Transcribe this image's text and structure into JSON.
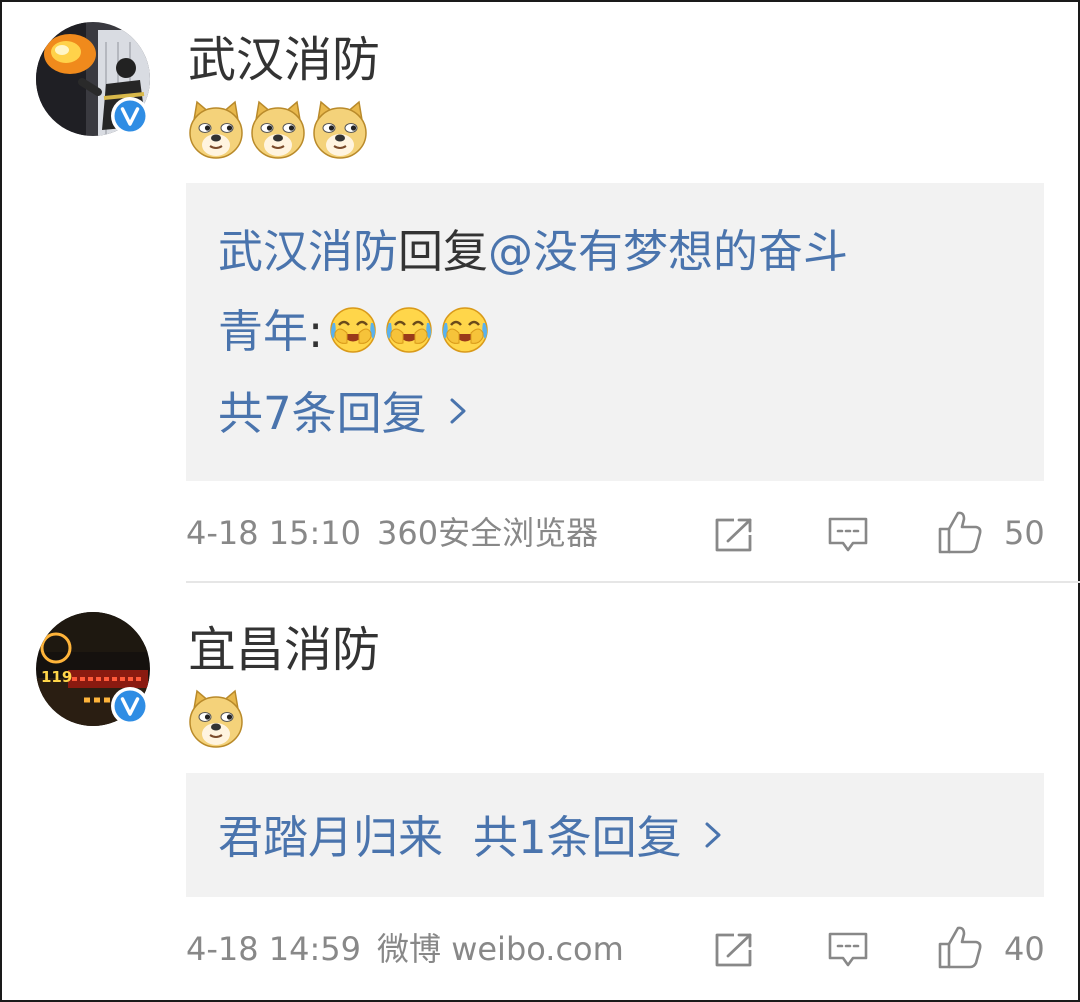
{
  "comments": [
    {
      "username": "武汉消防",
      "verified": true,
      "emoji_name": "doge",
      "emoji_count": 3,
      "reply_preview": {
        "author": "武汉消防",
        "verb": "回复",
        "mention_line1": "@没有梦想的奋斗",
        "mention_line2": "青年",
        "colon": ":",
        "emoji_name": "laugh-cry",
        "emoji_count": 3
      },
      "reply_count_label": "共7条回复",
      "timestamp": "4-18 15:10",
      "source": "360安全浏览器",
      "likes": "50"
    },
    {
      "username": "宜昌消防",
      "verified": true,
      "emoji_name": "doge",
      "emoji_count": 1,
      "avatar_sign_text": "119",
      "reply_preview": {
        "author": "君踏月归来"
      },
      "reply_count_label": "共1条回复",
      "timestamp": "4-18 14:59",
      "source": "微博 weibo.com",
      "likes": "40"
    }
  ],
  "colors": {
    "link_blue": "#4a74ad",
    "name_gray": "#333333",
    "meta_gray": "#888888",
    "reply_bg": "#f2f2f2",
    "verified_blue": "#2f8de4"
  },
  "icons": [
    "verified-badge-icon",
    "doge-emoji-icon",
    "laugh-cry-emoji-icon",
    "chevron-right-icon",
    "repost-icon",
    "comment-icon",
    "like-icon"
  ]
}
